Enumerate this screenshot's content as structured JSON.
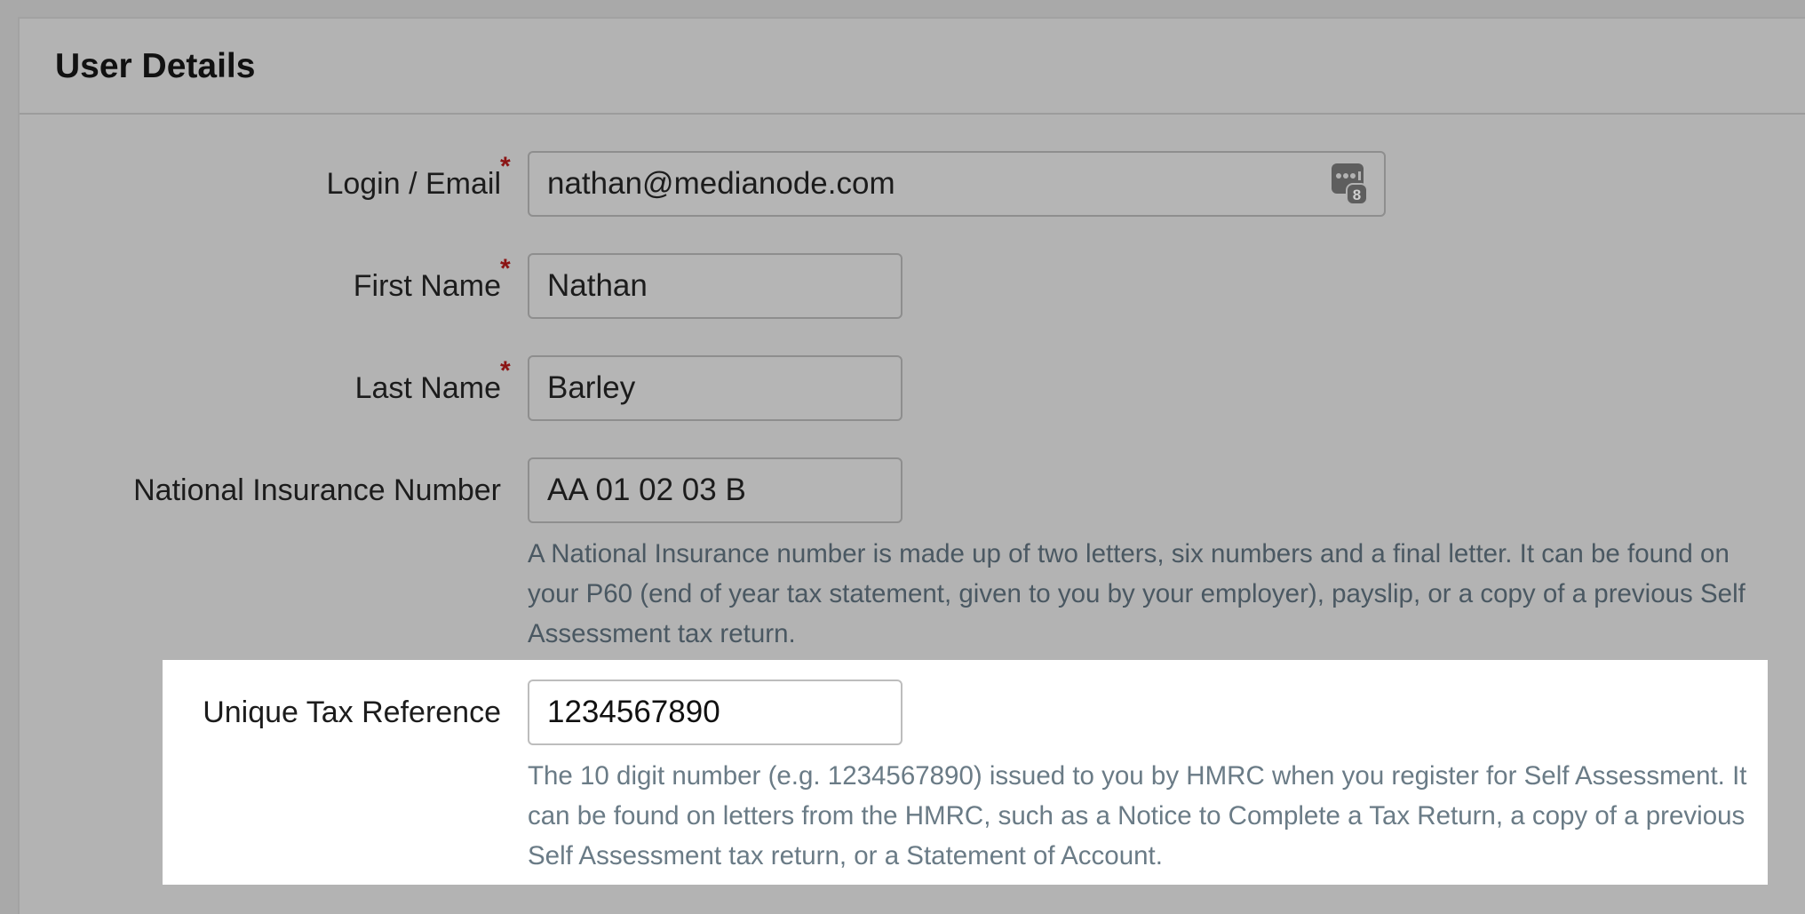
{
  "panel": {
    "title": "User Details"
  },
  "fields": {
    "login": {
      "label": "Login / Email",
      "required_mark": "*",
      "value": "nathan@medianode.com",
      "icon": "password-manager-icon"
    },
    "first_name": {
      "label": "First Name",
      "required_mark": "*",
      "value": "Nathan"
    },
    "last_name": {
      "label": "Last Name",
      "required_mark": "*",
      "value": "Barley"
    },
    "ni_number": {
      "label": "National Insurance Number",
      "value": "AA 01 02 03 B",
      "help": "A National Insurance number is made up of two letters, six numbers and a final letter. It can be found on your P60 (end of year tax statement, given to you by your employer), payslip, or a copy of a previous Self Assessment tax return."
    },
    "utr": {
      "label": "Unique Tax Reference",
      "value": "1234567890",
      "help": "The 10 digit number (e.g. 1234567890) issued to you by HMRC when you register for Self Assessment. It can be found on letters from the HMRC, such as a Notice to Complete a Tax Return, a copy of a previous Self Assessment tax return, or a Statement of Account."
    }
  },
  "colors": {
    "overlay_background": "#b3b3b3",
    "highlight_background": "#ffffff",
    "required_mark": "#8b1414",
    "help_text": "#4a5862"
  }
}
